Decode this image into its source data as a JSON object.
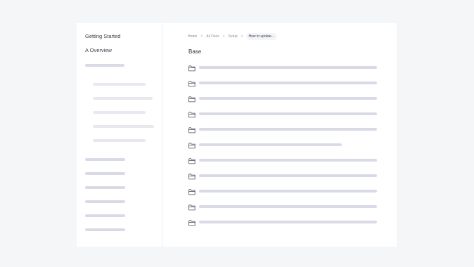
{
  "sidebar": {
    "heading": "Getting Started",
    "subheading": "A Overview"
  },
  "breadcrumb": {
    "items": [
      "Home",
      "All Docs",
      "Setup",
      "How to update..."
    ],
    "separator": ">"
  },
  "main": {
    "section_title": "Base",
    "file_count": 11
  },
  "icons": {
    "file_row": "folder-icon"
  }
}
